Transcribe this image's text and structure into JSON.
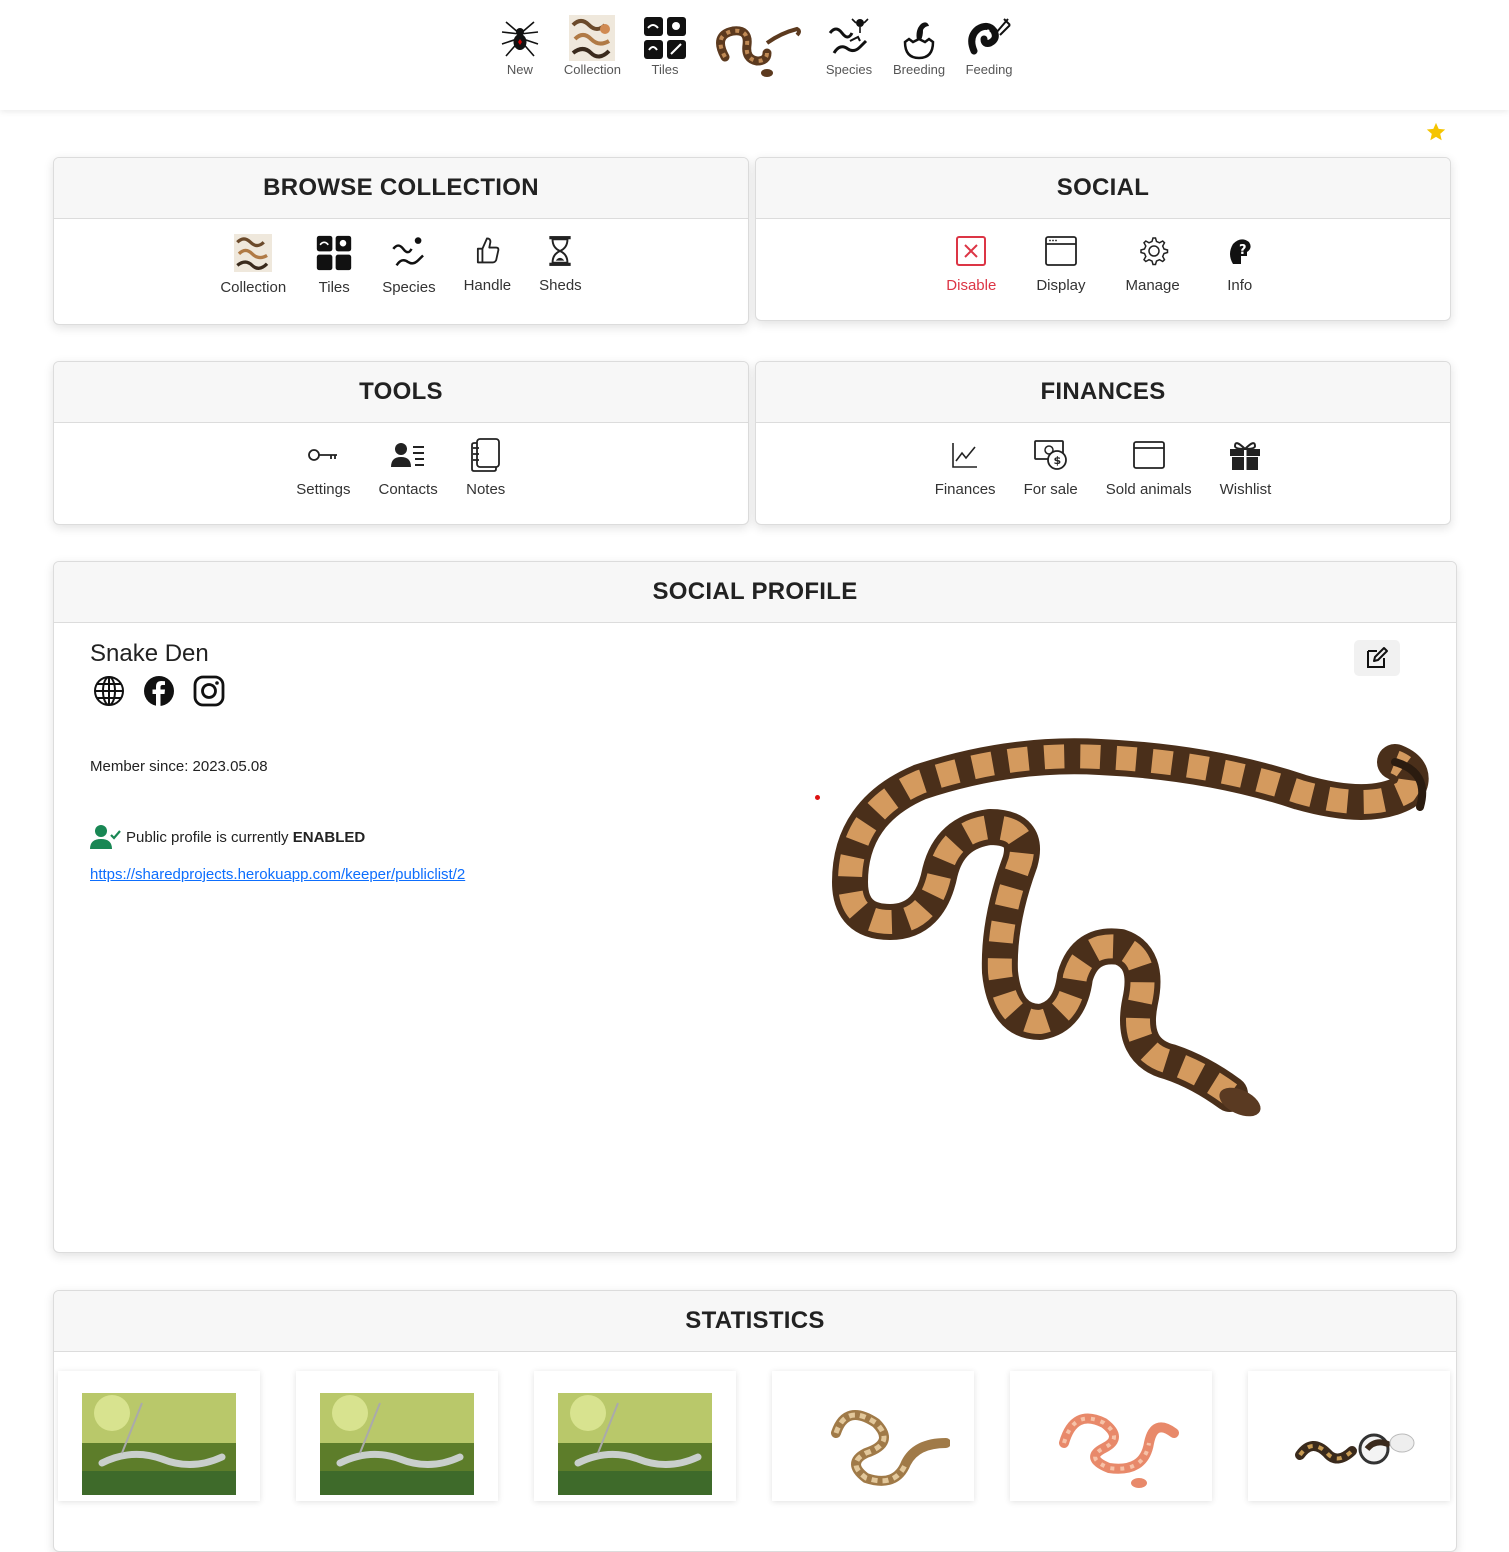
{
  "nav": {
    "items": [
      {
        "label": "New",
        "icon": "spider-icon"
      },
      {
        "label": "Collection",
        "icon": "collection-snakes-icon"
      },
      {
        "label": "Tiles",
        "icon": "tiles-icon"
      },
      {
        "label": "Species",
        "icon": "species-icon"
      },
      {
        "label": "Breeding",
        "icon": "hatching-egg-icon"
      },
      {
        "label": "Feeding",
        "icon": "feeding-icon"
      }
    ],
    "logo": "snake-logo"
  },
  "browse": {
    "title": "BROWSE COLLECTION",
    "items": [
      {
        "label": "Collection",
        "icon": "collection-snakes-icon"
      },
      {
        "label": "Tiles",
        "icon": "tiles-icon"
      },
      {
        "label": "Species",
        "icon": "species-icon"
      },
      {
        "label": "Handle",
        "icon": "thumbs-up-icon"
      },
      {
        "label": "Sheds",
        "icon": "hourglass-icon"
      }
    ]
  },
  "social": {
    "title": "SOCIAL",
    "items": [
      {
        "label": "Disable",
        "icon": "x-square-icon"
      },
      {
        "label": "Display",
        "icon": "window-icon"
      },
      {
        "label": "Manage",
        "icon": "gear-icon"
      },
      {
        "label": "Info",
        "icon": "question-head-icon"
      }
    ]
  },
  "tools": {
    "title": "TOOLS",
    "items": [
      {
        "label": "Settings",
        "icon": "key-icon"
      },
      {
        "label": "Contacts",
        "icon": "contacts-icon"
      },
      {
        "label": "Notes",
        "icon": "notes-icon"
      }
    ]
  },
  "finances": {
    "title": "FINANCES",
    "items": [
      {
        "label": "Finances",
        "icon": "line-chart-icon"
      },
      {
        "label": "For sale",
        "icon": "cash-icon"
      },
      {
        "label": "Sold animals",
        "icon": "window-icon"
      },
      {
        "label": "Wishlist",
        "icon": "gift-icon"
      }
    ]
  },
  "profile": {
    "title": "SOCIAL PROFILE",
    "name": "Snake Den",
    "member_since": "Member since: 2023.05.08",
    "public_prefix": "Public profile is currently ",
    "public_status": "ENABLED",
    "link": "https://sharedprojects.herokuapp.com/keeper/publiclist/2"
  },
  "statistics": {
    "title": "STATISTICS",
    "thumbs": [
      "green-snake-photo",
      "green-snake-photo",
      "green-snake-photo",
      "tan-python-photo",
      "orange-corn-snake-photo",
      "ball-pythons-photo"
    ]
  },
  "colors": {
    "accent_star": "#f5c400",
    "danger": "#dc3545",
    "success": "#198754",
    "link": "#0d6efd"
  }
}
